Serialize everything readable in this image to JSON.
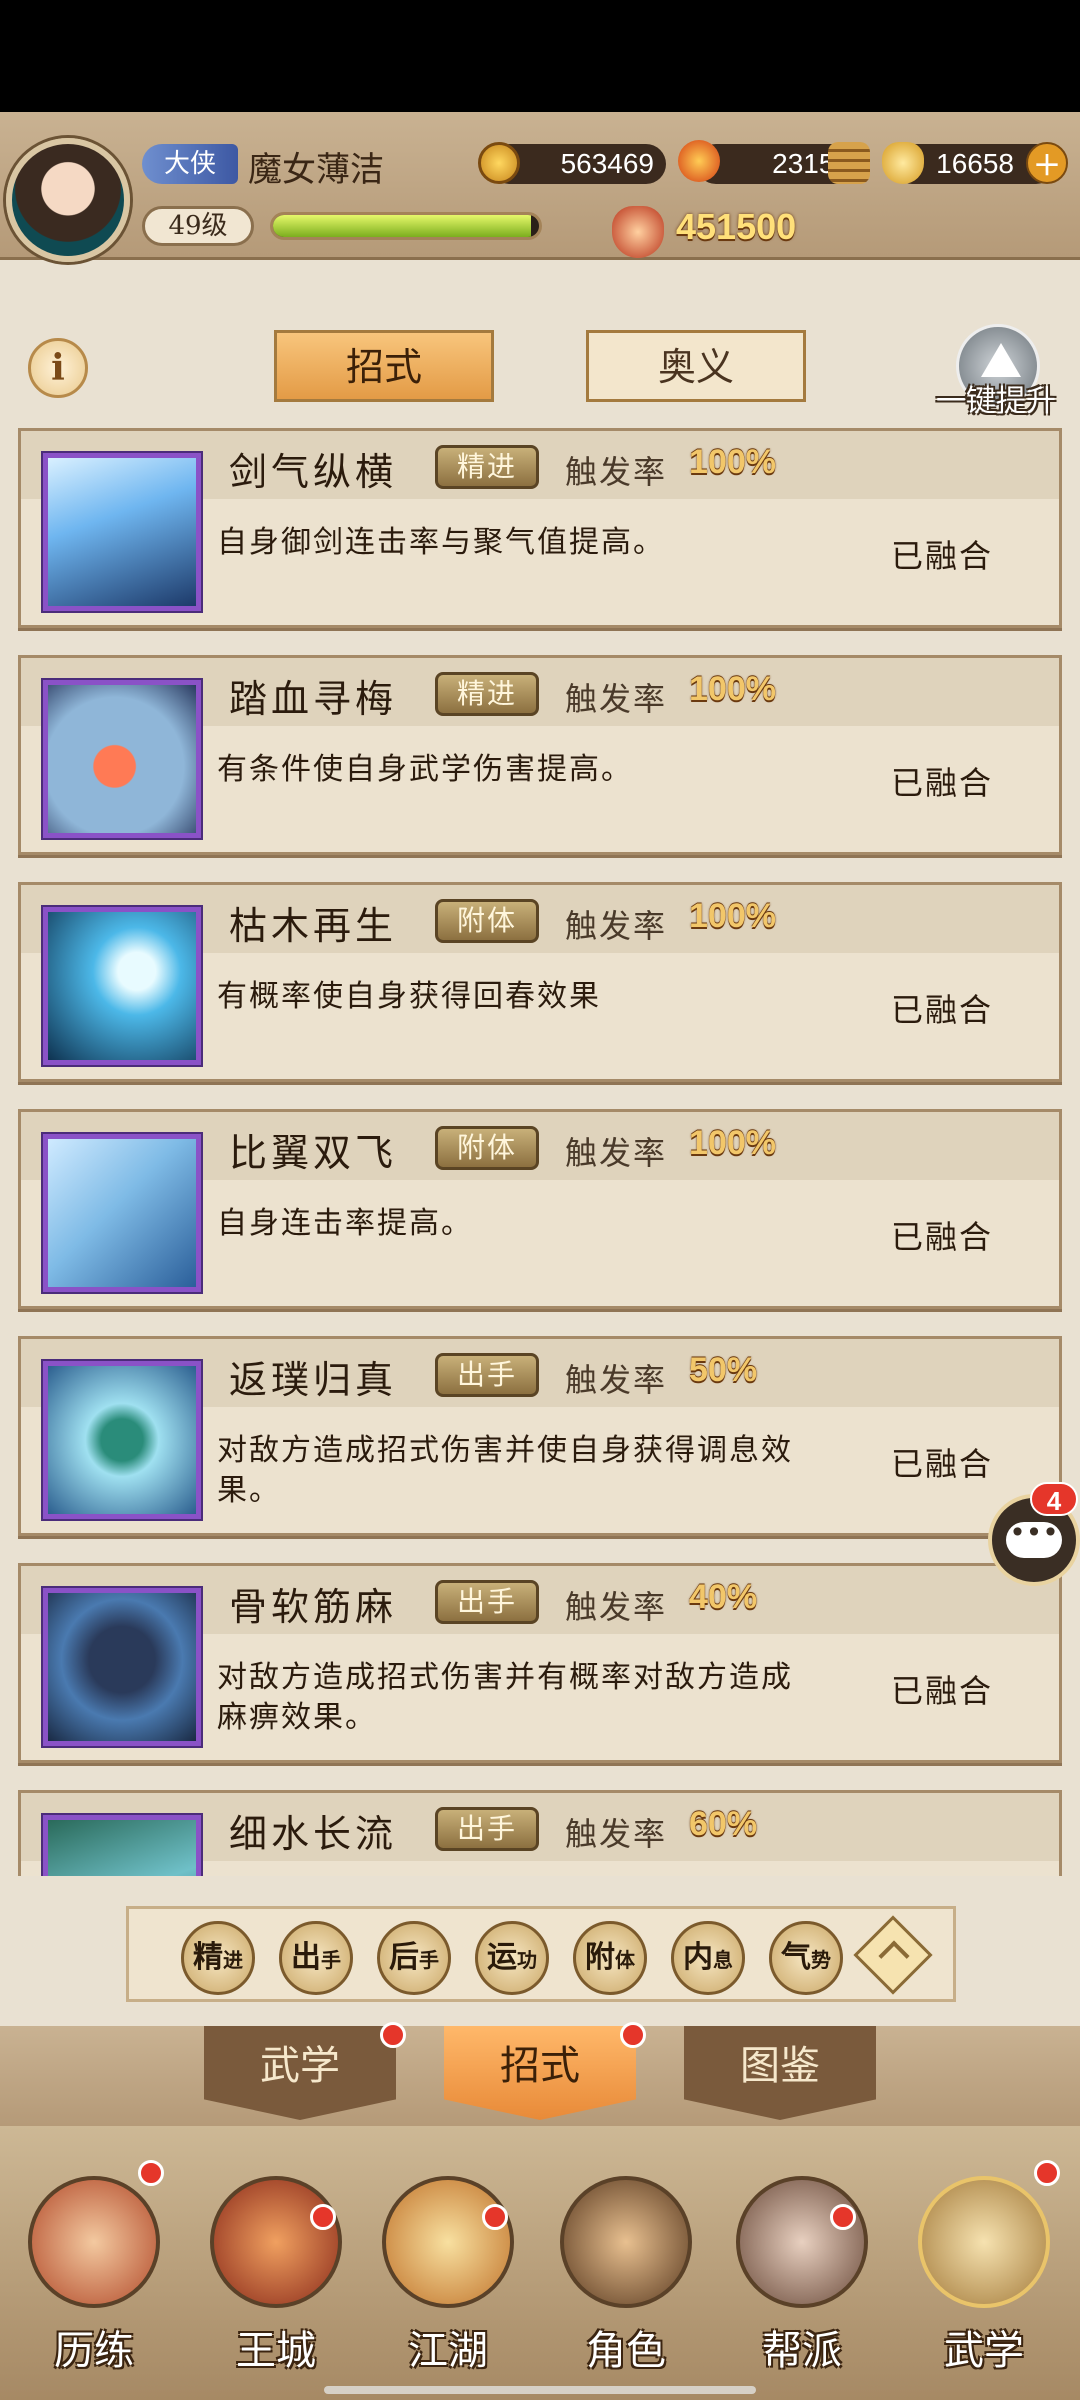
{
  "player": {
    "title_badge": "大侠",
    "name": "魔女薄洁",
    "level": "49级",
    "exp_fraction": 0.97,
    "coins": "563469",
    "flame": "23153",
    "ingots": "16658",
    "power": "451500"
  },
  "top_tabs": {
    "active": "招式",
    "inactive": "奥义",
    "upgrade_all": "一键提升"
  },
  "skills": [
    {
      "name": "剑气纵横",
      "tag": "精进",
      "rate_label": "触发率",
      "rate": "100%",
      "desc": "自身御剑连击率与聚气值提高。",
      "status": "已融合"
    },
    {
      "name": "踏血寻梅",
      "tag": "精进",
      "rate_label": "触发率",
      "rate": "100%",
      "desc": "有条件使自身武学伤害提高。",
      "status": "已融合"
    },
    {
      "name": "枯木再生",
      "tag": "附体",
      "rate_label": "触发率",
      "rate": "100%",
      "desc": "有概率使自身获得回春效果",
      "status": "已融合"
    },
    {
      "name": "比翼双飞",
      "tag": "附体",
      "rate_label": "触发率",
      "rate": "100%",
      "desc": "自身连击率提高。",
      "status": "已融合"
    },
    {
      "name": "返璞归真",
      "tag": "出手",
      "rate_label": "触发率",
      "rate": "50%",
      "desc": "对敌方造成招式伤害并使自身获得调息效果。",
      "status": "已融合"
    },
    {
      "name": "骨软筋麻",
      "tag": "出手",
      "rate_label": "触发率",
      "rate": "40%",
      "desc": "对敌方造成招式伤害并有概率对敌方造成麻痹效果。",
      "status": "已融合"
    },
    {
      "name": "细水长流",
      "tag": "出手",
      "rate_label": "触发率",
      "rate": "60%",
      "desc": "",
      "status": ""
    }
  ],
  "filters": [
    {
      "main": "精",
      "sub": "进"
    },
    {
      "main": "出",
      "sub": "手"
    },
    {
      "main": "后",
      "sub": "手"
    },
    {
      "main": "运",
      "sub": "功"
    },
    {
      "main": "附",
      "sub": "体"
    },
    {
      "main": "内",
      "sub": "息"
    },
    {
      "main": "气",
      "sub": "势"
    }
  ],
  "sub_tabs": [
    "武学",
    "招式",
    "图鉴"
  ],
  "bottom_nav": [
    "历练",
    "王城",
    "江湖",
    "角色",
    "帮派",
    "武学"
  ],
  "chat_badge": "4",
  "colors": {
    "accent": "#e39b46",
    "panel": "#ece2cf",
    "epic_border": "#8a52c7"
  }
}
